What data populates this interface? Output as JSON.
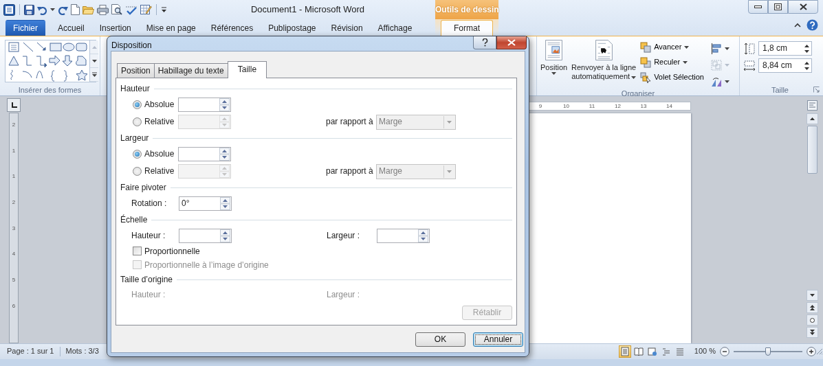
{
  "window": {
    "title": "Document1  -  Microsoft Word",
    "context_title": "Outils de dessin"
  },
  "ribbon_tabs": [
    {
      "label": "Fichier",
      "kind": "file",
      "selected": false
    },
    {
      "label": "Accueil",
      "kind": "normal",
      "selected": false
    },
    {
      "label": "Insertion",
      "kind": "normal",
      "selected": false
    },
    {
      "label": "Mise en page",
      "kind": "normal",
      "selected": false
    },
    {
      "label": "Références",
      "kind": "normal",
      "selected": false
    },
    {
      "label": "Publipostage",
      "kind": "normal",
      "selected": false
    },
    {
      "label": "Révision",
      "kind": "normal",
      "selected": false
    },
    {
      "label": "Affichage",
      "kind": "normal",
      "selected": false
    },
    {
      "label": "Format",
      "kind": "contextual",
      "selected": true
    }
  ],
  "ribbon": {
    "shapes_group": {
      "label": "Insérer des formes"
    },
    "organiser": {
      "label": "Organiser",
      "position": "Position",
      "wrap": "Renvoyer à la ligne automatiquement",
      "arrange": [
        {
          "label": "Avancer",
          "dropdown": true
        },
        {
          "label": "Reculer",
          "dropdown": true
        },
        {
          "label": "Volet Sélection",
          "dropdown": false
        }
      ]
    },
    "size": {
      "label": "Taille",
      "height": "1,8 cm",
      "width": "8,84 cm"
    }
  },
  "rulers": {
    "horizontal": [
      "9",
      "10",
      "11",
      "12",
      "13",
      "14"
    ],
    "vertical": [
      "2",
      "1",
      "1",
      "2",
      "3",
      "4",
      "5",
      "6"
    ]
  },
  "dialog": {
    "title": "Disposition",
    "tabs": [
      {
        "label": "Position",
        "selected": false
      },
      {
        "label": "Habillage du texte",
        "selected": false
      },
      {
        "label": "Taille",
        "selected": true
      }
    ],
    "sections": [
      {
        "title": "Hauteur",
        "rows": [
          {
            "kind": "radio",
            "label": "Absolue",
            "selected": true,
            "disabled": false
          },
          {
            "kind": "radio",
            "label": "Relative",
            "selected": false,
            "disabled": true,
            "relative_label": "par rapport à",
            "relative_to": "Marge"
          }
        ]
      },
      {
        "title": "Largeur",
        "rows": [
          {
            "kind": "radio",
            "label": "Absolue",
            "selected": true,
            "disabled": false
          },
          {
            "kind": "radio",
            "label": "Relative",
            "selected": false,
            "disabled": true,
            "relative_label": "par rapport à",
            "relative_to": "Marge"
          }
        ]
      },
      {
        "title": "Faire pivoter",
        "rows": [
          {
            "kind": "spin",
            "label": "Rotation :",
            "value": "0°"
          }
        ]
      },
      {
        "title": "Échelle",
        "rows": [
          {
            "kind": "spin_pair",
            "label": "Hauteur :",
            "label2": "Largeur :"
          },
          {
            "kind": "checkbox",
            "label": "Proportionnelle",
            "checked": false,
            "disabled": false
          },
          {
            "kind": "checkbox",
            "label": "Proportionnelle à l’image d’origine",
            "checked": false,
            "disabled": true
          }
        ]
      },
      {
        "title": "Taille d’origine",
        "rows": [
          {
            "kind": "info_pair",
            "label": "Hauteur :",
            "label2": "Largeur :",
            "disabled": true
          }
        ],
        "reset": {
          "label": "Rétablir",
          "disabled": true
        }
      }
    ],
    "buttons": [
      {
        "label": "OK",
        "focused": false
      },
      {
        "label": "Annuler",
        "focused": true
      }
    ]
  },
  "status_bar": {
    "page": "Page : 1 sur 1",
    "words": "Mots : 3/3",
    "views": [
      {
        "selected": true
      },
      {
        "selected": false
      },
      {
        "selected": false
      },
      {
        "selected": false
      },
      {
        "selected": false
      }
    ],
    "zoom": "100 %",
    "zoom_slider": {
      "level": 0.5
    }
  }
}
